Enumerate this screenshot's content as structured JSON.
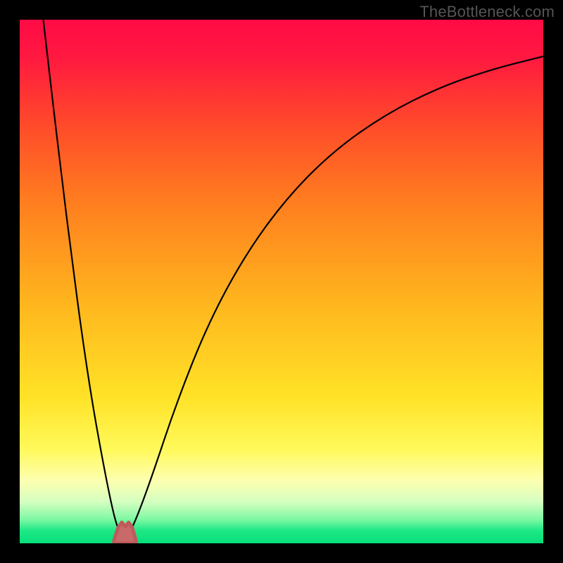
{
  "watermark": "TheBottleneck.com",
  "colors": {
    "frame_bg": "#000000",
    "gradient_stops": [
      {
        "offset": 0.0,
        "color": "#ff0b46"
      },
      {
        "offset": 0.07,
        "color": "#ff1840"
      },
      {
        "offset": 0.2,
        "color": "#ff4a2a"
      },
      {
        "offset": 0.35,
        "color": "#ff7e1f"
      },
      {
        "offset": 0.55,
        "color": "#ffb81e"
      },
      {
        "offset": 0.72,
        "color": "#ffe227"
      },
      {
        "offset": 0.82,
        "color": "#fff95a"
      },
      {
        "offset": 0.88,
        "color": "#fdffb0"
      },
      {
        "offset": 0.92,
        "color": "#d6ffc0"
      },
      {
        "offset": 0.955,
        "color": "#7cf7a3"
      },
      {
        "offset": 0.975,
        "color": "#1fe886"
      },
      {
        "offset": 1.0,
        "color": "#07df7a"
      }
    ],
    "curve": "#000000",
    "hump_fill": "#c86a6a",
    "hump_stroke": "#bf5a5a"
  },
  "chart_data": {
    "type": "line",
    "title": "",
    "xlabel": "",
    "ylabel": "",
    "xlim": [
      0,
      1
    ],
    "ylim": [
      0,
      1
    ],
    "grid": false,
    "legend": null,
    "notes": "Bottleneck-style curve. y≈0 (green) is optimal; y→1 (red) is severe bottleneck. Valley floor around x≈0.18–0.22 where a small pink 'V' hump sits just above the baseline.",
    "series": [
      {
        "name": "left-branch",
        "x": [
          0.045,
          0.06,
          0.08,
          0.1,
          0.12,
          0.14,
          0.16,
          0.175,
          0.185,
          0.195
        ],
        "y": [
          1.0,
          0.87,
          0.7,
          0.54,
          0.39,
          0.26,
          0.15,
          0.075,
          0.035,
          0.012
        ]
      },
      {
        "name": "right-branch",
        "x": [
          0.205,
          0.22,
          0.25,
          0.3,
          0.36,
          0.43,
          0.51,
          0.6,
          0.7,
          0.8,
          0.9,
          1.0
        ],
        "y": [
          0.012,
          0.04,
          0.12,
          0.27,
          0.42,
          0.55,
          0.66,
          0.75,
          0.82,
          0.87,
          0.905,
          0.93
        ]
      }
    ],
    "valley_hump": {
      "x": [
        0.18,
        0.188,
        0.195,
        0.202,
        0.208,
        0.215,
        0.222
      ],
      "y": [
        0.005,
        0.03,
        0.04,
        0.032,
        0.04,
        0.03,
        0.005
      ]
    }
  }
}
